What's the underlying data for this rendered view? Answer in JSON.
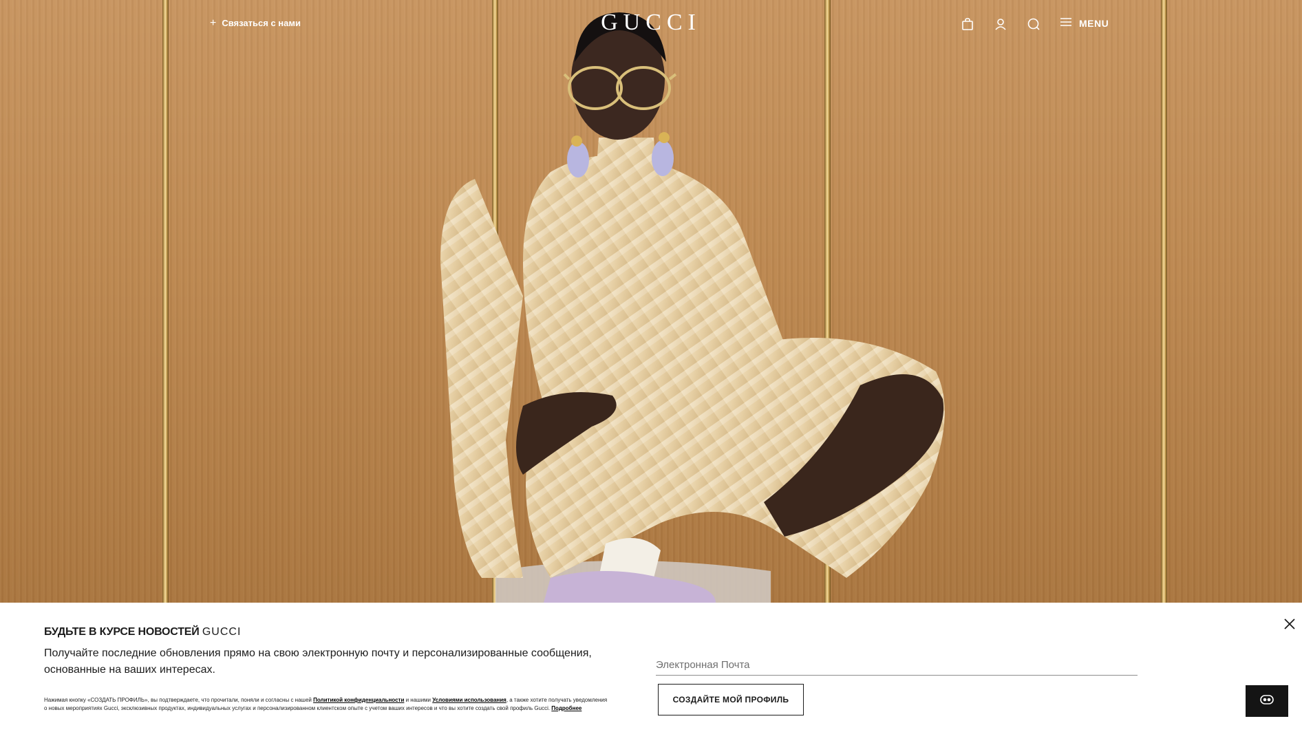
{
  "header": {
    "contact_plus": "+",
    "contact_label": "Связаться с нами",
    "logo": "GUCCI",
    "menu_label": "MENU"
  },
  "icons": {
    "contact": "plus-icon",
    "bag": "shopping-bag-icon",
    "account": "user-icon",
    "search": "search-icon",
    "menu": "hamburger-icon",
    "close": "close-icon",
    "chat": "chat-icon"
  },
  "newsletter": {
    "title": "БУДЬТЕ В КУРСЕ НОВОСТЕЙ",
    "title_brand": "GUCCI",
    "description": "Получайте последние обновления прямо на свою электронную почту и персонализированные сообщения, основанные на ваших интересах.",
    "legal_part1": "Нажимая кнопку «СОЗДАТЬ ПРОФИЛЬ», вы подтверждаете, что прочитали, поняли и согласны с нашей ",
    "privacy_link": "Политикой конфиденциальности",
    "legal_part2": " и нашими ",
    "terms_link": "Условиями использования",
    "legal_part3": ", а также хотите получать уведомления о новых мероприятиях Gucci, эксклюзивных продуктах, индивидуальных услугах и персонализированном клиентском опыте с учетом ваших интересов и что вы хотите создать свой профиль Gucci. ",
    "more_link": "Подробнее",
    "email_placeholder": "Электронная Почта",
    "email_value": "",
    "create_button": "СОЗДАЙТЕ МОЙ ПРОФИЛЬ"
  },
  "colors": {
    "header_text": "#ffffff",
    "wood_panel": "#bd8850",
    "brass_trim": "#e2c27a",
    "newsletter_bg": "#ffffff",
    "chat_button_bg": "#141414"
  }
}
